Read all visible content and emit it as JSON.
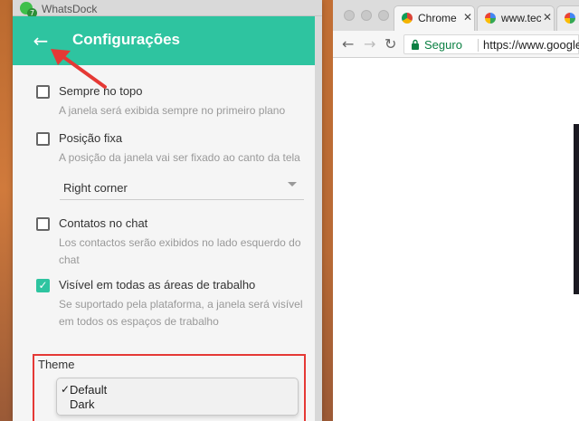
{
  "whatsdock": {
    "window_title": "WhatsDock",
    "app_badge": "7",
    "header_title": "Configurações",
    "options": [
      {
        "label": "Sempre no topo",
        "desc": "A janela será exibida sempre no primeiro plano",
        "checked": false
      },
      {
        "label": "Posição fixa",
        "desc": "A posição da janela vai ser fixado ao canto da tela",
        "checked": false
      },
      {
        "label": "Contatos no chat",
        "desc": "Los contactos serão exibidos no lado esquerdo do chat",
        "checked": false
      },
      {
        "label": "Visível em todas as áreas de trabalho",
        "desc": "Se suportado pela plataforma, a janela será visível em todos os espaços de trabalho",
        "checked": true
      }
    ],
    "position_select": {
      "value": "Right corner"
    },
    "theme": {
      "label": "Theme",
      "options": [
        "Default",
        "Dark"
      ],
      "selected": "Default",
      "check_mark": "✓"
    }
  },
  "chrome": {
    "tabs": [
      {
        "title": "Chrome",
        "icon": "chrome-icon",
        "active": true
      },
      {
        "title": "www.tec",
        "icon": "google-icon",
        "active": false
      },
      {
        "title": "",
        "icon": "google-icon",
        "active": false
      }
    ],
    "security_label": "Seguro",
    "url": "https://www.google.co"
  },
  "colors": {
    "accent": "#2ec4a0",
    "annotation": "#e53935",
    "secure": "#0b8043"
  }
}
